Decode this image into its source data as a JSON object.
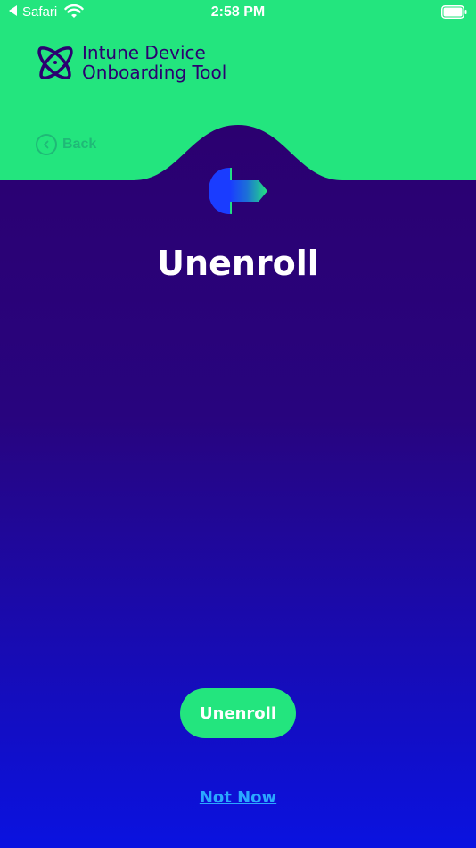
{
  "status_bar": {
    "back_app": "Safari",
    "time": "2:58 PM",
    "icons": [
      "back-arrow-icon",
      "wifi-icon",
      "battery-icon"
    ]
  },
  "header": {
    "title_line1": "Intune Device",
    "title_line2": "Onboarding Tool",
    "back_label": "Back",
    "icons": [
      "logo-icon",
      "chevron-left-icon"
    ]
  },
  "main": {
    "title": "Unenroll",
    "hero_icon": "unenroll-icon"
  },
  "actions": {
    "primary_label": "Unenroll",
    "secondary_label": "Not Now"
  },
  "colors": {
    "header_green": "#23e57e",
    "deep_purple": "#2b0070",
    "bottom_blue": "#0a12e0",
    "link_blue": "#2aa8ff",
    "back_green": "#1fb977"
  }
}
